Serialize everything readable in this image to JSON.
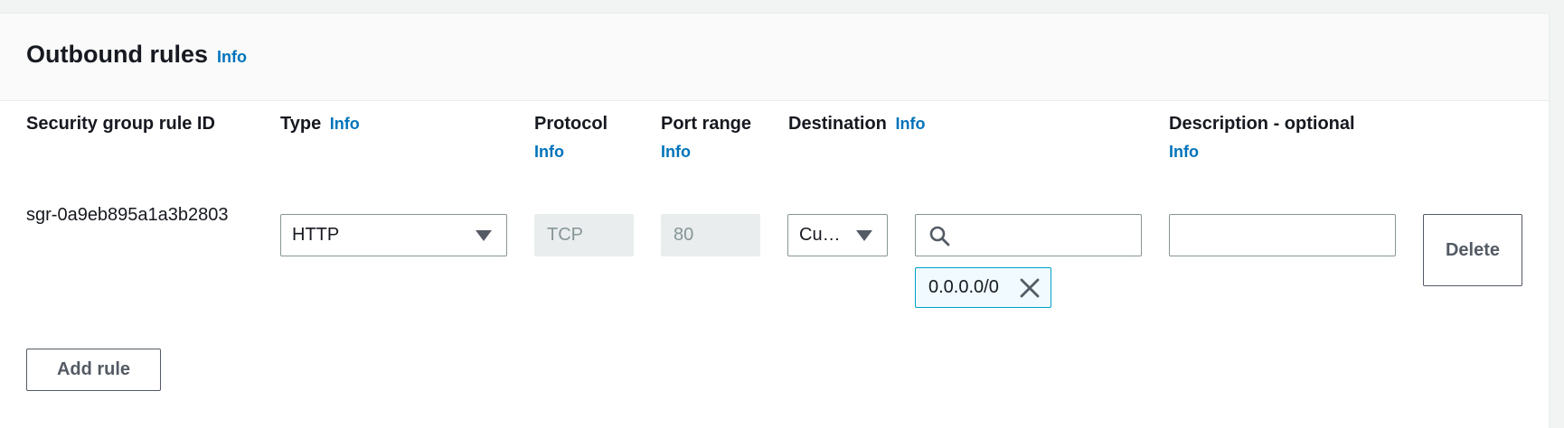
{
  "section": {
    "title": "Outbound rules",
    "info": "Info"
  },
  "columns": {
    "rule_id": "Security group rule ID",
    "type": "Type",
    "type_info": "Info",
    "protocol": "Protocol",
    "protocol_info": "Info",
    "port_range": "Port range",
    "port_range_info": "Info",
    "destination": "Destination",
    "destination_info": "Info",
    "description": "Description - optional",
    "description_info": "Info"
  },
  "rule": {
    "id": "sgr-0a9eb895a1a3b2803",
    "type": "HTTP",
    "protocol": "TCP",
    "port_range": "80",
    "destination_type": "Cu…",
    "destination_search": "",
    "destination_token": "0.0.0.0/0",
    "description": "",
    "delete_label": "Delete"
  },
  "actions": {
    "add_rule": "Add rule"
  },
  "icons": {
    "dropdown": "caret-down-icon",
    "search": "search-icon",
    "remove": "close-icon"
  },
  "colors": {
    "link": "#0073bb",
    "token_border": "#00a1c9",
    "token_bg": "#f1faff"
  }
}
